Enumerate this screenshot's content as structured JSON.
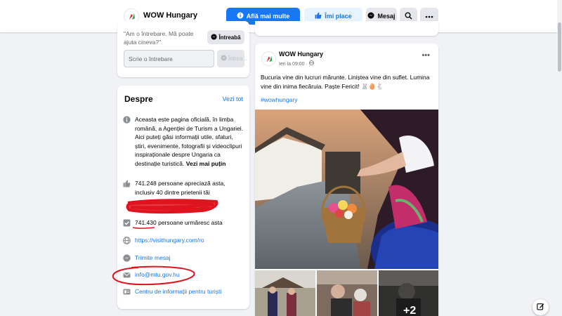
{
  "header": {
    "page_name": "WOW Hungary",
    "learn_more_label": "Află mai multe",
    "like_label": "Îmi place",
    "message_label": "Mesaj"
  },
  "ask": {
    "prompt": "\"Am o întrebare. Mă poate ajuta cineva?\"",
    "ask_button": "Întreabă",
    "input_placeholder": "Scrie o întrebare",
    "send_label": "Întrea..."
  },
  "about": {
    "title": "Despre",
    "see_all": "Vezi tot",
    "description": "Aceasta este pagina oficială, în limba română, a Agenției de Turism a Ungariei. Aici puteți găsi informații utile, sfaturi, știri, evenimente, fotografii și videoclipuri inspiraționale despre Ungaria ca destinație turistică.",
    "see_more": "Vezi mai puțin",
    "likes_text": "741.248 persoane apreciază asta, inclusiv 40 dintre prietenii tăi",
    "followers_count": "741.430",
    "followers_text": " persoane urmăresc asta",
    "website": "https://visithungary.com/ro",
    "send_message": "Trimite mesaj",
    "email": "info@mtu.gov.hu",
    "info_center": "Centru de informații pentru turiști"
  },
  "post": {
    "author": "WOW Hungary",
    "time": "Ieri la 09:00 · ",
    "text": "Bucuria vine din lucruri mărunte. Liniștea vine din suflet. Lumina vine din inima fiecăruia. Paște Fericit! 🐰🥚🐇",
    "hashtag": "#wowhungary",
    "more_photos": "+2"
  },
  "colors": {
    "accent": "#1877f2",
    "background": "#f0f2f5",
    "annotation_red": "#e0141e"
  }
}
